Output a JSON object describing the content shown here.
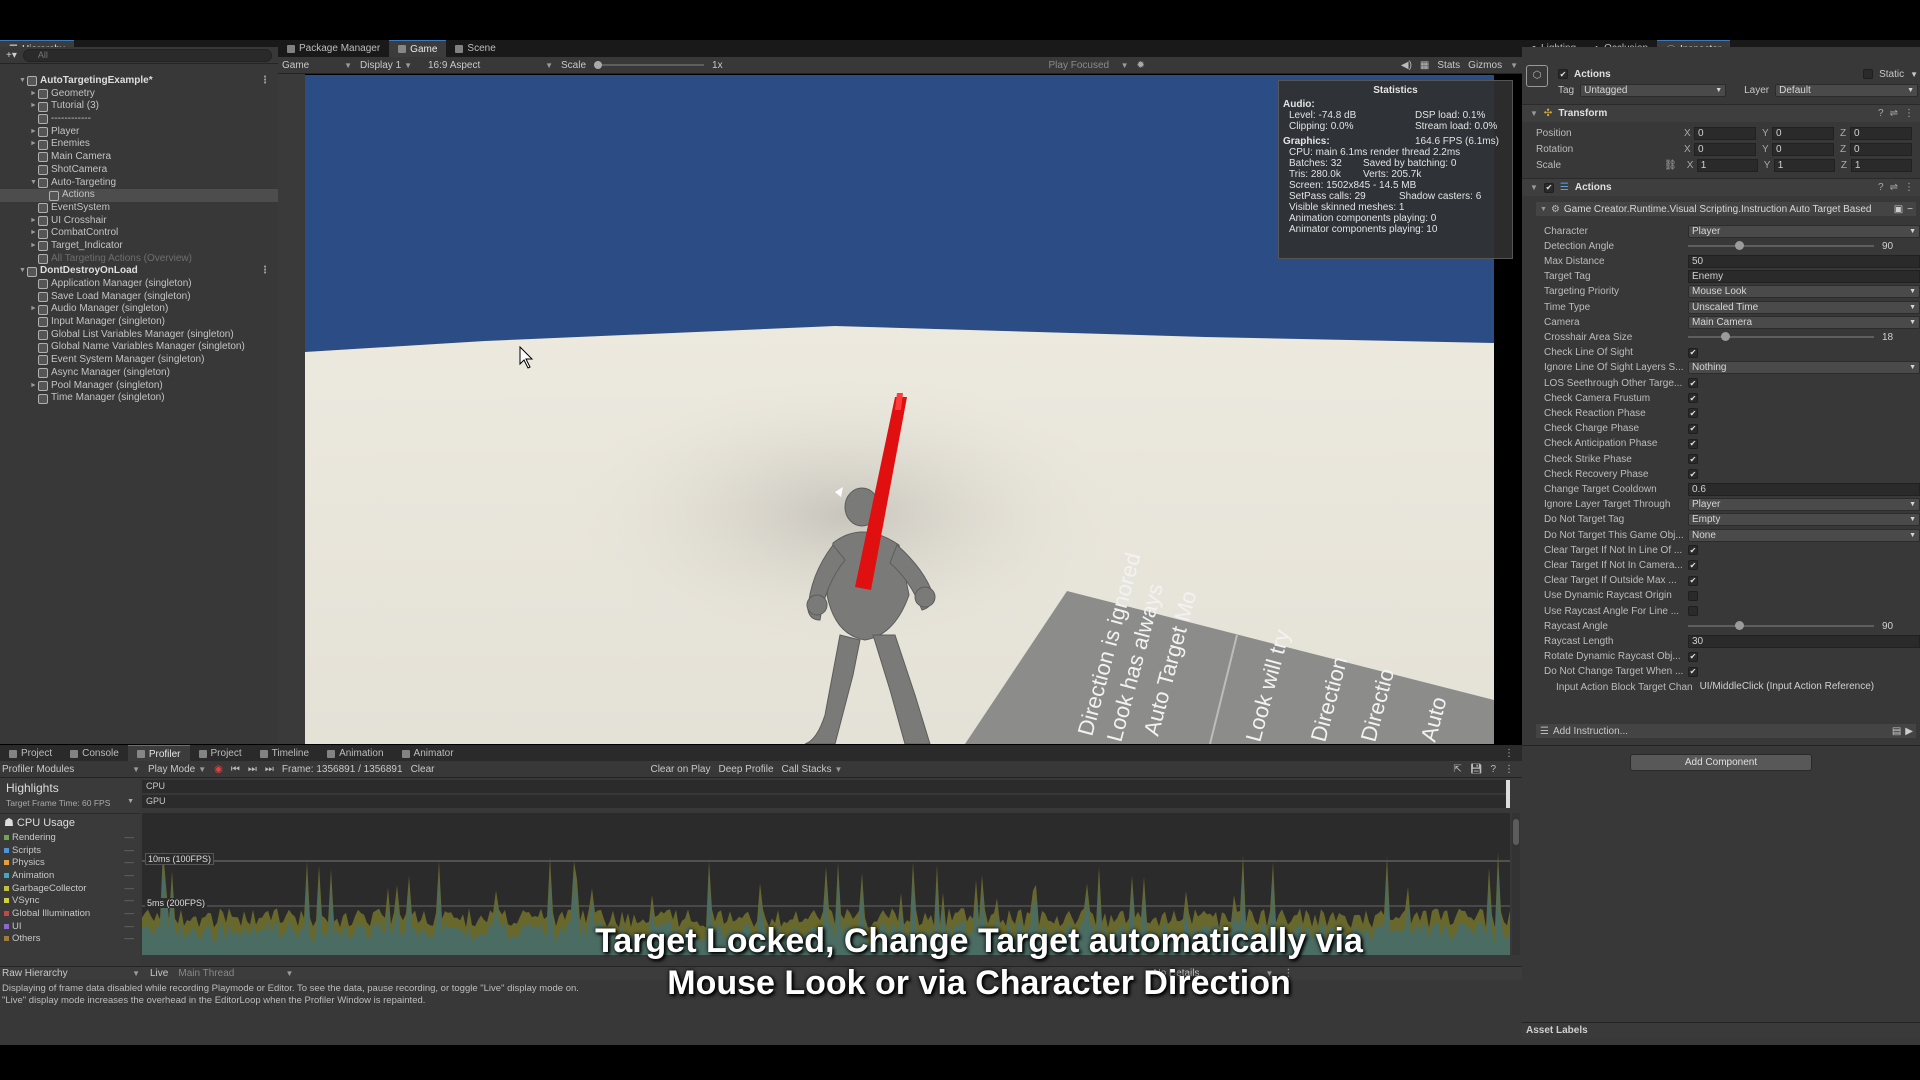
{
  "hierarchy": {
    "tab": "Hierarchy",
    "search_placeholder": "All",
    "rows": [
      {
        "label": "AutoTargetingExample*",
        "level": 0,
        "arrow": "▼",
        "root": true
      },
      {
        "label": "Geometry",
        "level": 1,
        "arrow": "►"
      },
      {
        "label": "Tutorial (3)",
        "level": 1,
        "arrow": "►"
      },
      {
        "label": "------------",
        "level": 1,
        "arrow": ""
      },
      {
        "label": "Player",
        "level": 1,
        "arrow": "►"
      },
      {
        "label": "Enemies",
        "level": 1,
        "arrow": "►"
      },
      {
        "label": "Main Camera",
        "level": 1,
        "arrow": ""
      },
      {
        "label": "ShotCamera",
        "level": 1,
        "arrow": ""
      },
      {
        "label": "Auto-Targeting",
        "level": 1,
        "arrow": "▼"
      },
      {
        "label": "Actions",
        "level": 2,
        "arrow": "",
        "selected": true
      },
      {
        "label": "EventSystem",
        "level": 1,
        "arrow": ""
      },
      {
        "label": "UI Crosshair",
        "level": 1,
        "arrow": "►"
      },
      {
        "label": "CombatControl",
        "level": 1,
        "arrow": "►"
      },
      {
        "label": "Target_Indicator",
        "level": 1,
        "arrow": "►"
      },
      {
        "label": "All Targeting Actions (Overview)",
        "level": 1,
        "arrow": "",
        "dim": true
      },
      {
        "label": "DontDestroyOnLoad",
        "level": 0,
        "arrow": "▼",
        "root": true
      },
      {
        "label": "Application Manager (singleton)",
        "level": 1,
        "arrow": ""
      },
      {
        "label": "Save Load Manager (singleton)",
        "level": 1,
        "arrow": ""
      },
      {
        "label": "Audio Manager (singleton)",
        "level": 1,
        "arrow": "►"
      },
      {
        "label": "Input Manager (singleton)",
        "level": 1,
        "arrow": ""
      },
      {
        "label": "Global List Variables Manager (singleton)",
        "level": 1,
        "arrow": ""
      },
      {
        "label": "Global Name Variables Manager (singleton)",
        "level": 1,
        "arrow": ""
      },
      {
        "label": "Event System Manager (singleton)",
        "level": 1,
        "arrow": ""
      },
      {
        "label": "Async Manager (singleton)",
        "level": 1,
        "arrow": ""
      },
      {
        "label": "Pool Manager (singleton)",
        "level": 1,
        "arrow": "►"
      },
      {
        "label": "Time Manager (singleton)",
        "level": 1,
        "arrow": ""
      }
    ]
  },
  "center_tabs": [
    "Package Manager",
    "Game",
    "Scene"
  ],
  "game_toolbar": {
    "mode": "Game",
    "display": "Display 1",
    "aspect": "16:9 Aspect",
    "scale_label": "Scale",
    "scale_value": "1x",
    "play_focused": "Play Focused",
    "stats": "Stats",
    "gizmos": "Gizmos"
  },
  "statistics": {
    "title": "Statistics",
    "audio_label": "Audio:",
    "level": "Level: -74.8 dB",
    "clipping": "Clipping: 0.0%",
    "dsp": "DSP load: 0.1%",
    "stream": "Stream load: 0.0%",
    "graphics_label": "Graphics:",
    "fps": "164.6 FPS (6.1ms)",
    "cpu": "CPU: main 6.1ms  render thread 2.2ms",
    "batches": "Batches: 32",
    "saved": "Saved by batching: 0",
    "tris": "Tris: 280.0k",
    "verts": "Verts: 205.7k",
    "screen": "Screen: 1502x845 - 14.5 MB",
    "setpass": "SetPass calls: 29",
    "shadow": "Shadow casters: 6",
    "skinned": "Visible skinned meshes: 1",
    "anim": "Animation components playing: 0",
    "animator": "Animator components playing: 10"
  },
  "scene_sign_lines": [
    "Direction is ignored",
    "Look has always",
    "Auto Target Mo",
    "Look will try",
    "Direction",
    "Directio",
    "Auto"
  ],
  "right_tabs": [
    "Lighting",
    "Occlusion",
    "Inspector"
  ],
  "inspector": {
    "object_name": "Actions",
    "static_label": "Static",
    "tag_label": "Tag",
    "tag_value": "Untagged",
    "layer_label": "Layer",
    "layer_value": "Default",
    "transform_header": "Transform",
    "position_label": "Position",
    "rotation_label": "Rotation",
    "scale_label": "Scale",
    "position": [
      "0",
      "0",
      "0"
    ],
    "rotation": [
      "0",
      "0",
      "0"
    ],
    "scale": [
      "1",
      "1",
      "1"
    ],
    "actions_header": "Actions",
    "instruction_title": "Game Creator.Runtime.Visual Scripting.Instruction Auto Target Based",
    "add_instruction": "Add Instruction...",
    "add_component": "Add Component",
    "asset_labels": "Asset Labels",
    "props": [
      {
        "label": "Character",
        "type": "dropdown",
        "value": "Player"
      },
      {
        "label": "Detection Angle",
        "type": "slider",
        "value": "90",
        "pos": 0.25
      },
      {
        "label": "Max Distance",
        "type": "field",
        "value": "50"
      },
      {
        "label": "Target Tag",
        "type": "field",
        "value": "Enemy"
      },
      {
        "label": "Targeting Priority",
        "type": "dropdown",
        "value": "Mouse Look"
      },
      {
        "label": "Time Type",
        "type": "dropdown",
        "value": "Unscaled Time"
      },
      {
        "label": "Camera",
        "type": "dropdown",
        "value": "Main Camera"
      },
      {
        "label": "Crosshair Area Size",
        "type": "slider",
        "value": "18",
        "pos": 0.18
      },
      {
        "label": "Check Line Of Sight",
        "type": "check",
        "value": "✔"
      },
      {
        "label": "Ignore Line Of Sight Layers S...",
        "type": "dropdown",
        "value": "Nothing"
      },
      {
        "label": "LOS Seethrough Other Targe...",
        "type": "check",
        "value": "✔"
      },
      {
        "label": "Check Camera Frustum",
        "type": "check",
        "value": "✔"
      },
      {
        "label": "Check Reaction Phase",
        "type": "check",
        "value": "✔"
      },
      {
        "label": "Check Charge Phase",
        "type": "check",
        "value": "✔"
      },
      {
        "label": "Check Anticipation Phase",
        "type": "check",
        "value": "✔"
      },
      {
        "label": "Check Strike Phase",
        "type": "check",
        "value": "✔"
      },
      {
        "label": "Check Recovery Phase",
        "type": "check",
        "value": "✔"
      },
      {
        "label": "Change Target Cooldown",
        "type": "field",
        "value": "0.6"
      },
      {
        "label": "Ignore Layer Target Through",
        "type": "dropdown",
        "value": "Player"
      },
      {
        "label": "Do Not Target Tag",
        "type": "dropdown",
        "value": "Empty"
      },
      {
        "label": "Do Not Target This Game Obj...",
        "type": "dropdown",
        "value": "None"
      },
      {
        "label": "Clear Target If Not In Line Of ...",
        "type": "check",
        "value": "✔"
      },
      {
        "label": "Clear Target If Not In Camera...",
        "type": "check",
        "value": "✔"
      },
      {
        "label": "Clear Target If Outside Max ...",
        "type": "check",
        "value": "✔"
      },
      {
        "label": "Use Dynamic Raycast Origin",
        "type": "check",
        "value": ""
      },
      {
        "label": "Use Raycast Angle For Line ...",
        "type": "check",
        "value": ""
      },
      {
        "label": "Raycast Angle",
        "type": "slider",
        "value": "90",
        "pos": 0.25
      },
      {
        "label": "Raycast Length",
        "type": "field",
        "value": "30"
      },
      {
        "label": "Rotate Dynamic Raycast Obj...",
        "type": "check",
        "value": "✔"
      },
      {
        "label": "Do Not Change Target When ...",
        "type": "check",
        "value": "✔"
      },
      {
        "label": "Input Action Block Target Chan",
        "type": "field",
        "value": "UI/MiddleClick (Input Action Reference)"
      }
    ]
  },
  "bottom_tabs": [
    "Project",
    "Console",
    "Profiler",
    "Project",
    "Timeline",
    "Animation",
    "Animator"
  ],
  "profiler": {
    "modules": "Profiler Modules",
    "play_mode": "Play Mode",
    "frame": "Frame: 1356891 / 1356891",
    "clear": "Clear",
    "clear_on_play": "Clear on Play",
    "deep_profile": "Deep Profile",
    "call_stacks": "Call Stacks",
    "highlights": "Highlights",
    "target_frame": "Target Frame Time: 60 FPS",
    "cpu": "CPU",
    "gpu": "GPU",
    "cpu_usage": "CPU Usage",
    "categories": [
      {
        "name": "Rendering",
        "color": "#6ba84f"
      },
      {
        "name": "Scripts",
        "color": "#4f95d6"
      },
      {
        "name": "Physics",
        "color": "#e0a040"
      },
      {
        "name": "Animation",
        "color": "#40a8c0"
      },
      {
        "name": "GarbageCollector",
        "color": "#c0c040"
      },
      {
        "name": "VSync",
        "color": "#d0d040"
      },
      {
        "name": "Global Illumination",
        "color": "#c04a4a"
      },
      {
        "name": "UI",
        "color": "#8a6ac8"
      },
      {
        "name": "Others",
        "color": "#a07a40"
      }
    ],
    "label_10ms": "10ms (100FPS)",
    "label_5ms": "5ms (200FPS)",
    "raw_hierarchy": "Raw Hierarchy",
    "live": "Live",
    "main_thread": "Main Thread",
    "no_details": "No Details",
    "notice_1": "Displaying of frame data disabled while recording Playmode or Editor. To see the data, pause recording, or toggle \"Live\" display mode on.",
    "notice_2": "\"Live\" display mode increases the overhead in the EditorLoop when the Profiler Window is repainted."
  },
  "subtitle": {
    "line1": "Target Locked, Change Target automatically via",
    "line2": "Mouse Look or via Character Direction"
  },
  "colors": {
    "sky": "#2c4c85",
    "laser": "#e01010",
    "accent": "#3a79bb"
  }
}
